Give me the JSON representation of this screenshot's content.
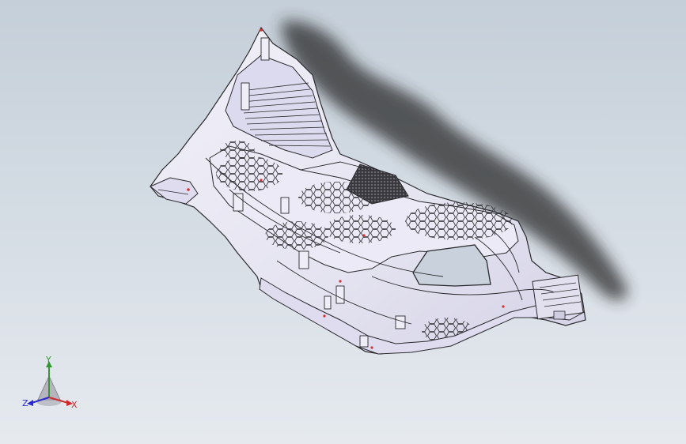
{
  "viewport": {
    "background_top": "#c5cfd9",
    "background_bottom": "#e6eaef",
    "model": "plastic-interior-trim-panel",
    "model_fill": "#e7e6f2",
    "model_edge": "#2a2a2e",
    "shadow_color": "#2c2c2c",
    "feature_colors": {
      "datum_points": "#d83030"
    }
  },
  "triad": {
    "x_label": "X",
    "y_label": "Y",
    "z_label": "Z",
    "x_color": "#d02a2a",
    "y_color": "#2e9a2e",
    "z_color": "#2a2ad0"
  }
}
